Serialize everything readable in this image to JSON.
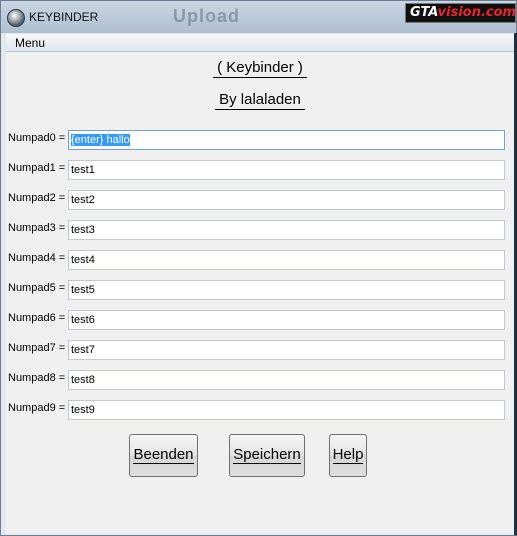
{
  "window": {
    "title": "KEYBINDER",
    "background_label": "Upload"
  },
  "watermark": {
    "part1": "GTA",
    "part2": "vision.com"
  },
  "menu": {
    "label": "Menu"
  },
  "header": {
    "title": "( Keybinder )",
    "subtitle": "By lalaladen"
  },
  "rows": [
    {
      "label": "Numpad0 =",
      "value": "{enter} hallo"
    },
    {
      "label": "Numpad1 =",
      "value": "test1"
    },
    {
      "label": "Numpad2 =",
      "value": "test2"
    },
    {
      "label": "Numpad3 =",
      "value": "test3"
    },
    {
      "label": "Numpad4 =",
      "value": "test4"
    },
    {
      "label": "Numpad5 =",
      "value": "test5"
    },
    {
      "label": "Numpad6 =",
      "value": "test6"
    },
    {
      "label": "Numpad7 =",
      "value": "test7"
    },
    {
      "label": "Numpad8 =",
      "value": "test8"
    },
    {
      "label": "Numpad9 =",
      "value": "test9"
    }
  ],
  "buttons": {
    "quit": "Beenden",
    "save": "Speichern",
    "help": "Help"
  },
  "colors": {
    "selection": "#3399ff",
    "focus_border": "#6ea2d9"
  }
}
